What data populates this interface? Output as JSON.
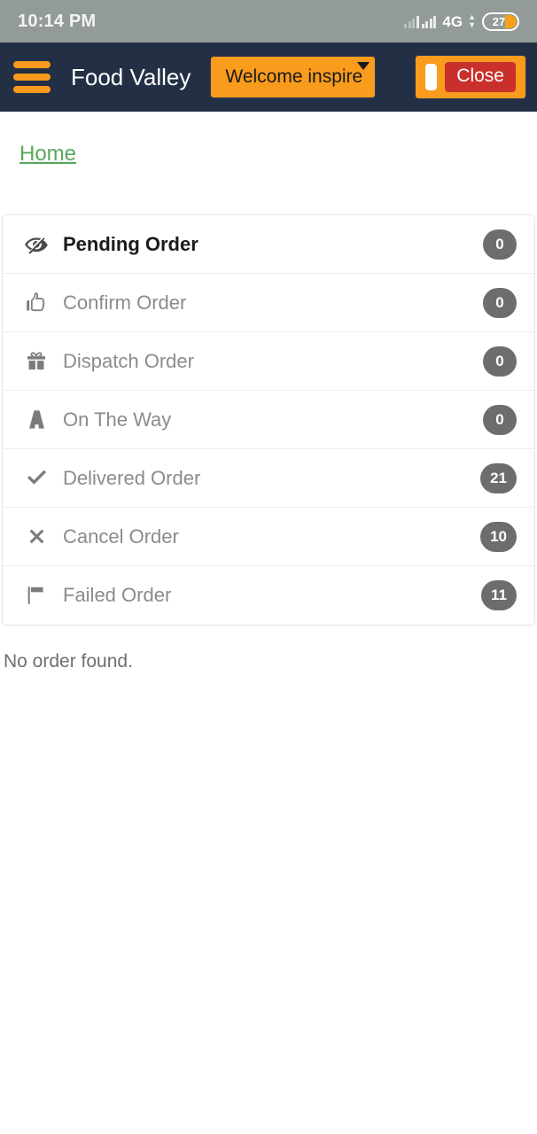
{
  "statusbar": {
    "time": "10:14 PM",
    "network_label": "4G",
    "battery_percent": "27",
    "signal_icon": "signal-bars-icon",
    "battery_icon": "battery-icon"
  },
  "navbar": {
    "menu_icon": "hamburger-menu-icon",
    "brand": "Food Valley",
    "welcome_label": "Welcome inspire",
    "caret_icon": "chevron-down-icon",
    "close_label": "Close",
    "power_icon": "power-icon",
    "bg_color": "#232f45",
    "accent_color": "#f99b1c",
    "close_color": "#c9302c"
  },
  "breadcrumb": {
    "home_label": "Home",
    "home_color": "#57a85c"
  },
  "orders": {
    "rows": [
      {
        "label": "Pending Order",
        "count": "0",
        "icon": "eye-slash-icon",
        "active": true
      },
      {
        "label": "Confirm Order",
        "count": "0",
        "icon": "thumbs-up-icon",
        "active": false
      },
      {
        "label": "Dispatch Order",
        "count": "0",
        "icon": "gift-icon",
        "active": false
      },
      {
        "label": "On The Way",
        "count": "0",
        "icon": "road-icon",
        "active": false
      },
      {
        "label": "Delivered Order",
        "count": "21",
        "icon": "check-icon",
        "active": false
      },
      {
        "label": "Cancel Order",
        "count": "10",
        "icon": "times-icon",
        "active": false
      },
      {
        "label": "Failed Order",
        "count": "11",
        "icon": "flag-icon",
        "active": false
      }
    ],
    "badge_color": "#6d6d6d"
  },
  "main": {
    "empty_message": "No order found."
  }
}
